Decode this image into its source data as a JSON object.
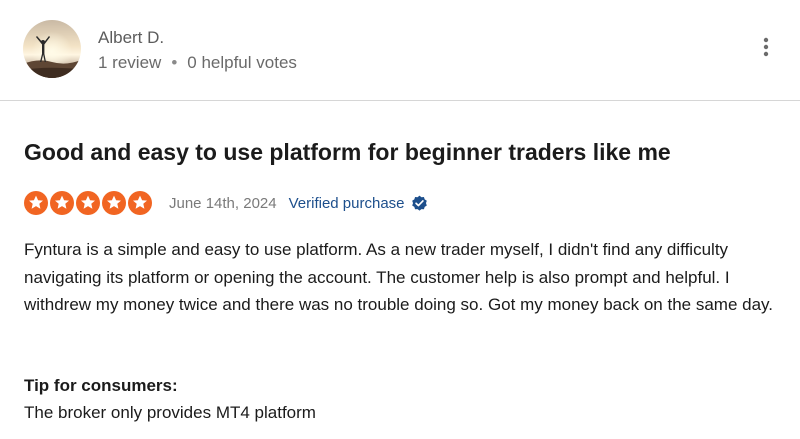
{
  "author": {
    "name": "Albert D.",
    "reviews": "1 review",
    "separator": "•",
    "helpful_votes": "0 helpful votes",
    "avatar_icon": "user-photo-avatar"
  },
  "menu": {
    "icon": "more-vertical-icon"
  },
  "review": {
    "title": "Good and easy to use platform for beginner traders like me",
    "rating": 5,
    "rating_max": 5,
    "star_color": "#f16522",
    "date": "June 14th, 2024",
    "verified_label": "Verified purchase",
    "verified_color": "#1d4f8c",
    "body": "Fyntura is a simple and easy to use platform. As a new trader myself, I didn't find any difficulty navigating its platform or opening the account. The customer help is also prompt and helpful. I withdrew my money twice and there was no trouble doing so. Got my money back on the same day.",
    "tip_heading": "Tip for consumers:",
    "tip_text": "The broker only provides MT4 platform"
  }
}
